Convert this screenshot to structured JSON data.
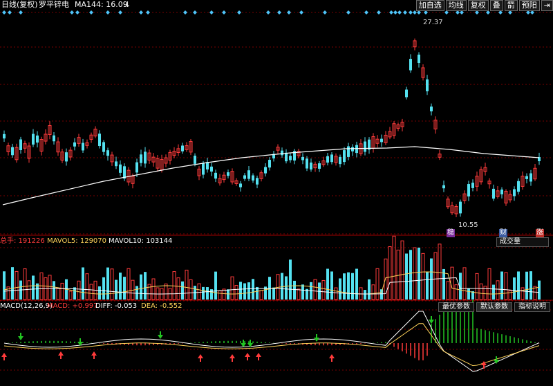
{
  "top": {
    "period": "日线(复权)",
    "stock": "罗平锌电",
    "ma": "MA144: 16.09",
    "ma_arrow": "↓",
    "buttons": [
      "加自选",
      "均线",
      "复权",
      "叠",
      "箭",
      "预阳"
    ],
    "nav_icon": "⇥"
  },
  "price": {
    "high_label": "27.37",
    "low_label": "10.55",
    "markers": [
      "稳",
      "财",
      "涨"
    ]
  },
  "volume": {
    "total_label": "总手: 191226",
    "mavol5_label": "MAVOL5: 129070",
    "mavol10_label": "MAVOL10: 103144",
    "selector": "成交量"
  },
  "macd": {
    "title": "MACD(12,26,9)",
    "macd_label": "MACD: +0.997",
    "diff_label": "DIFF: -0.053",
    "dea_label": "DEA: -0.552",
    "tabs": [
      "最优参数",
      "默认参数",
      "指标说明"
    ]
  },
  "colors": {
    "up": "#ff3b3b",
    "down": "#54e1f0",
    "ma": "#ffffff",
    "ma5": "#ffd35a",
    "macd_neg": "#22c522",
    "grid": "#7a0000",
    "diamond": "#4fc3f7"
  }
}
